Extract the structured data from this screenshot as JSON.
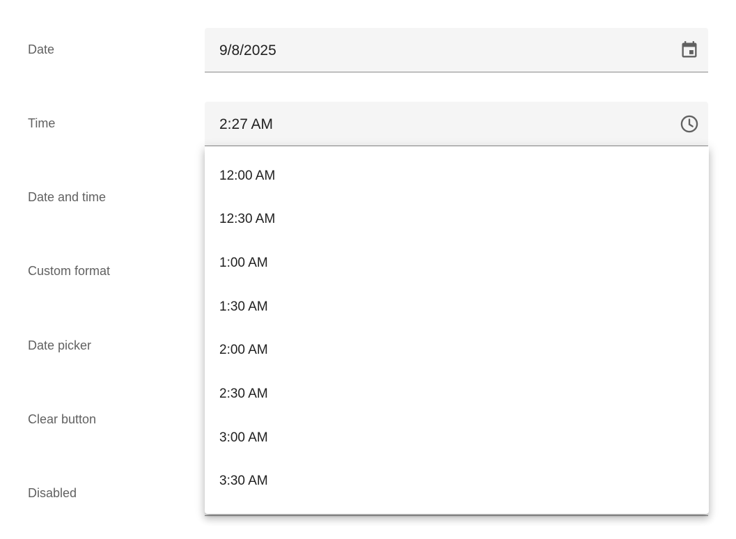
{
  "labels": {
    "date": "Date",
    "time": "Time",
    "date_and_time": "Date and time",
    "custom_format": "Custom format",
    "date_picker": "Date picker",
    "clear_button": "Clear button",
    "disabled": "Disabled"
  },
  "date_field": {
    "value": "9/8/2025",
    "icon": "calendar-icon"
  },
  "time_field": {
    "value": "2:27 AM",
    "icon": "clock-icon"
  },
  "time_options": [
    "12:00 AM",
    "12:30 AM",
    "1:00 AM",
    "1:30 AM",
    "2:00 AM",
    "2:30 AM",
    "3:00 AM",
    "3:30 AM"
  ],
  "colors": {
    "field_bg": "#f5f5f5",
    "label_text": "#616161",
    "icon": "#616161",
    "text": "#212121"
  }
}
